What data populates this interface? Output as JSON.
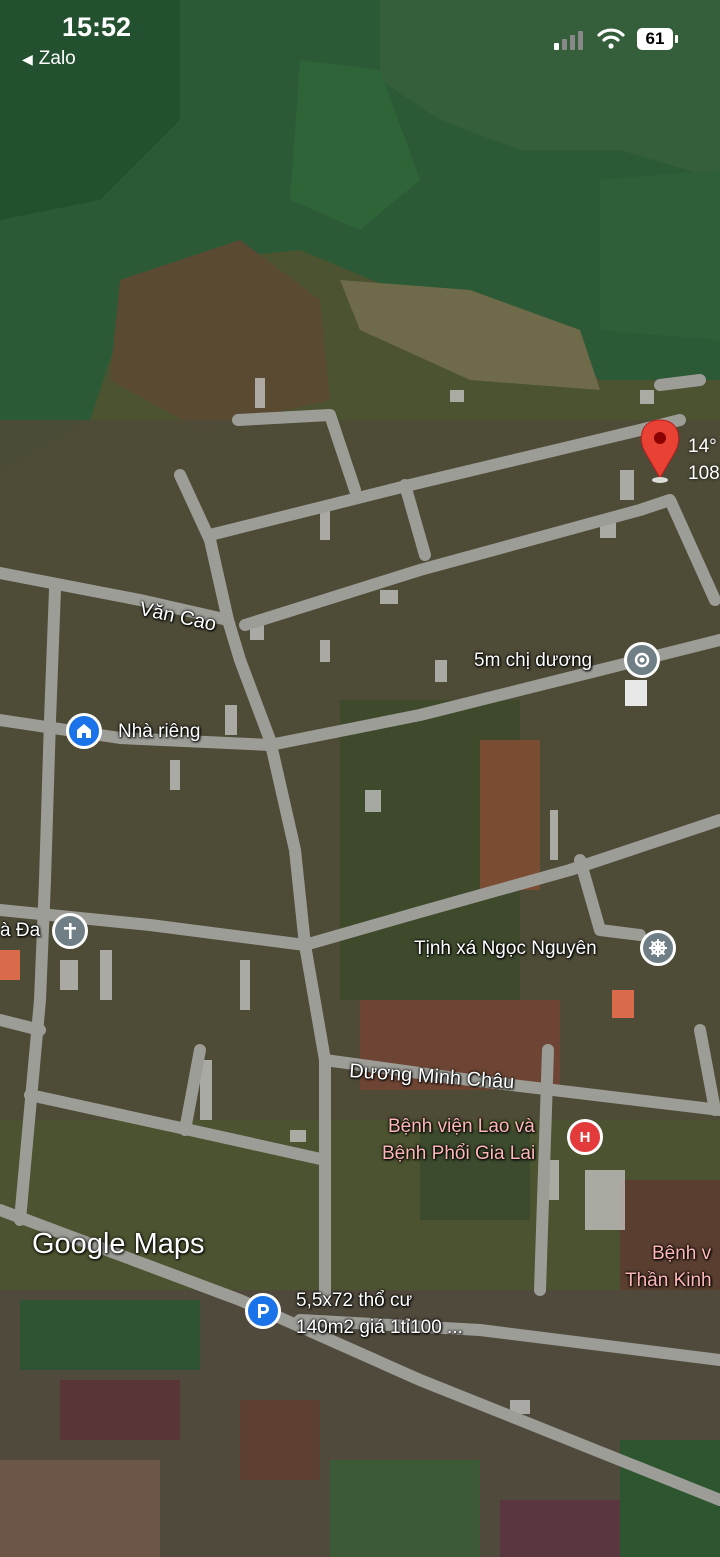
{
  "status_bar": {
    "time": "15:52",
    "back_app": "Zalo",
    "battery": "61"
  },
  "map": {
    "pin_coords": [
      "14°",
      "108"
    ],
    "streets": [
      "Văn Cao",
      "Dương Minh Châu"
    ],
    "places": [
      {
        "name": "5m chị dương",
        "icon": "place-pin-icon"
      },
      {
        "name": "Nhà riêng",
        "icon": "home-icon"
      },
      {
        "name": "à Đa",
        "icon": "church-icon"
      },
      {
        "name": "Tịnh xá Ngọc Nguyên",
        "icon": "dharma-wheel-icon"
      },
      {
        "name_lines": [
          "Bệnh viện Lao và",
          "Bệnh Phổi Gia Lai"
        ],
        "icon": "hospital-icon"
      },
      {
        "name_lines": [
          "Bệnh v",
          "Thần Kinh"
        ]
      },
      {
        "name_lines": [
          "5,5x72 thổ cư",
          "140m2 giá 1tỉ100 ..."
        ],
        "icon": "parking-icon"
      }
    ],
    "watermark": "Google Maps",
    "colors": {
      "road": "#9d9d97",
      "red_pin": "#e94235",
      "poi_gray": "#6f7f85",
      "home_blue": "#1a73e8",
      "hospital_red": "#e33b3b"
    }
  }
}
